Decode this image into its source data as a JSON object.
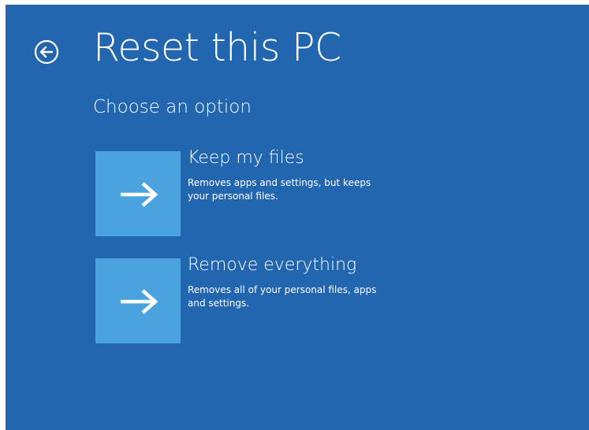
{
  "colors": {
    "background": "#2266b0",
    "tile": "#4aa3df",
    "text": "#ffffff"
  },
  "header": {
    "back_icon": "back-arrow-circle-icon",
    "title": "Reset this PC"
  },
  "main": {
    "subtitle": "Choose an option",
    "options": [
      {
        "icon": "arrow-right-icon",
        "title": "Keep my files",
        "description": "Removes apps and settings, but keeps your personal files."
      },
      {
        "icon": "arrow-right-icon",
        "title": "Remove everything",
        "description": "Removes all of your personal files, apps and settings."
      }
    ]
  }
}
